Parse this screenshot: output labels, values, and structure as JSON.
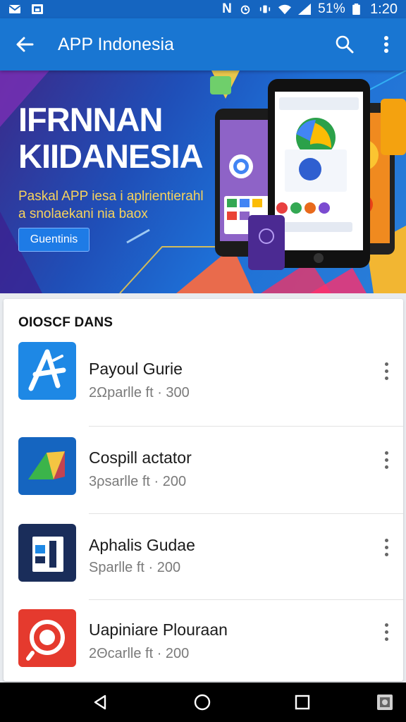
{
  "status_bar": {
    "battery": "51%",
    "time": "1:20",
    "icons": [
      "mail-icon",
      "image-icon",
      "nfc-icon",
      "alarm-icon",
      "vibrate-icon",
      "wifi-icon",
      "signal-icon",
      "battery-icon"
    ]
  },
  "app_bar": {
    "title": "APP Indonesia",
    "icons": [
      "back-arrow-icon",
      "search-icon",
      "more-vert-icon"
    ]
  },
  "banner": {
    "title_line1": "IFRNNAN",
    "title_line2": "KIIDANESIA",
    "subtitle_line1": "Paskal APP iesa i aplrientierahl",
    "subtitle_line2": "a snolaekani nia baox",
    "cta_label": "Guentinis"
  },
  "section": {
    "title": "OIOSCF DANS"
  },
  "apps": [
    {
      "name": "Payoul Gurie",
      "meta": "2Ωparlle ft · 300",
      "icon": "star-app-icon",
      "color": "#1e88e5"
    },
    {
      "name": "Cospill actator",
      "meta": "3ρsarlle ft · 200",
      "icon": "triangle-app-icon",
      "color": "#1565c0"
    },
    {
      "name": "Aphalis Gudae",
      "meta": "Sparlle ft · 200",
      "icon": "bars-app-icon",
      "color": "#1a2d5a"
    },
    {
      "name": "Uapiniare Plouraan",
      "meta": "2Θcarlle ft · 200",
      "icon": "ring-app-icon",
      "color": "#e53a2e"
    }
  ],
  "nav_bar": {
    "icons": [
      "back-triangle-icon",
      "home-circle-icon",
      "recents-square-icon",
      "screenshot-icon"
    ]
  }
}
